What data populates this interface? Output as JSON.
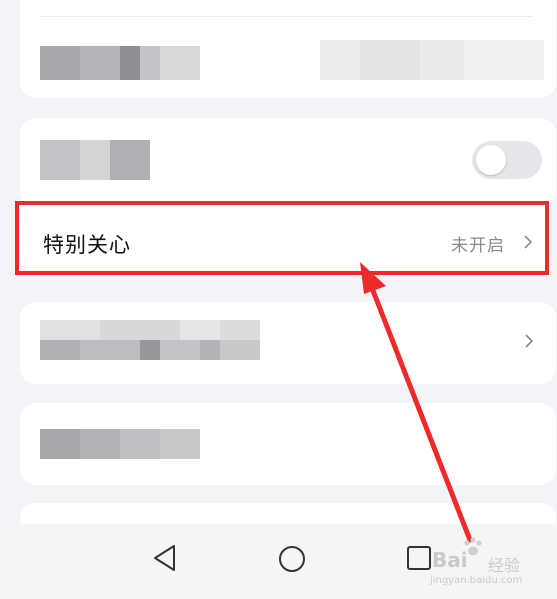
{
  "special_care": {
    "label": "特别关心",
    "status": "未开启"
  },
  "watermark": {
    "brand": "Bai",
    "brand_cn": "经验",
    "url": "jingyan.baidu.com"
  },
  "colors": {
    "highlight": "#ee2b2b",
    "background": "#f3f4f8",
    "card": "#ffffff"
  },
  "icons": [
    "chevron-right-icon",
    "back-icon",
    "home-icon",
    "recents-icon",
    "paw-icon"
  ]
}
